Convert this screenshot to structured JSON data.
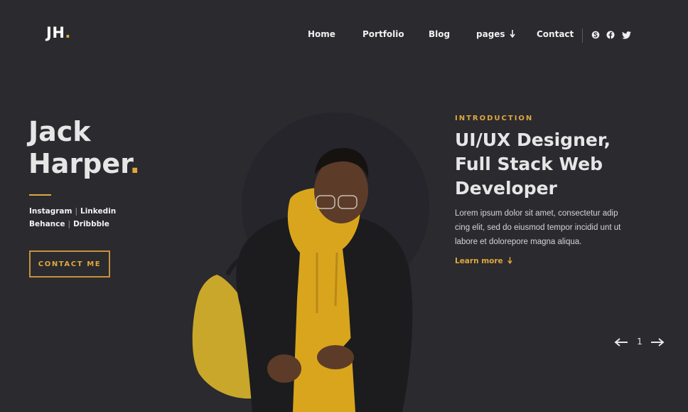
{
  "logo": {
    "text": "JH",
    "dot": "."
  },
  "nav": {
    "items": [
      {
        "label": "Home"
      },
      {
        "label": "Portfolio"
      },
      {
        "label": "Blog"
      },
      {
        "label": "pages",
        "icon": "arrow-down-icon"
      },
      {
        "label": "Contact"
      }
    ],
    "social_icons": [
      "skype-icon",
      "facebook-icon",
      "twitter-icon"
    ]
  },
  "hero": {
    "first_name": "Jack",
    "last_name": "Harper",
    "name_dot": ".",
    "social_row1": [
      "Instagram",
      "Linkedin"
    ],
    "social_row2": [
      "Behance",
      "Dribbble"
    ],
    "separator": "|",
    "contact_button": "CONTACT ME"
  },
  "intro": {
    "label": "INTRODUCTION",
    "headline_lines": [
      "UI/UX Designer,",
      "Full Stack Web",
      "Developer"
    ],
    "body_lines": [
      "Lorem ipsum dolor sit amet, consectetur adip",
      "cing elit, sed do eiusmod tempor incidid unt ut",
      "labore et dolorepore magna aliqua."
    ],
    "learn_more": "Learn more",
    "learn_more_icon": "arrow-down-icon"
  },
  "pager": {
    "current": "1",
    "prev_icon": "arrow-left-icon",
    "next_icon": "arrow-right-icon"
  },
  "colors": {
    "background": "#2a2a2f",
    "accent": "#e0a83a",
    "text": "#e6e6e6"
  }
}
